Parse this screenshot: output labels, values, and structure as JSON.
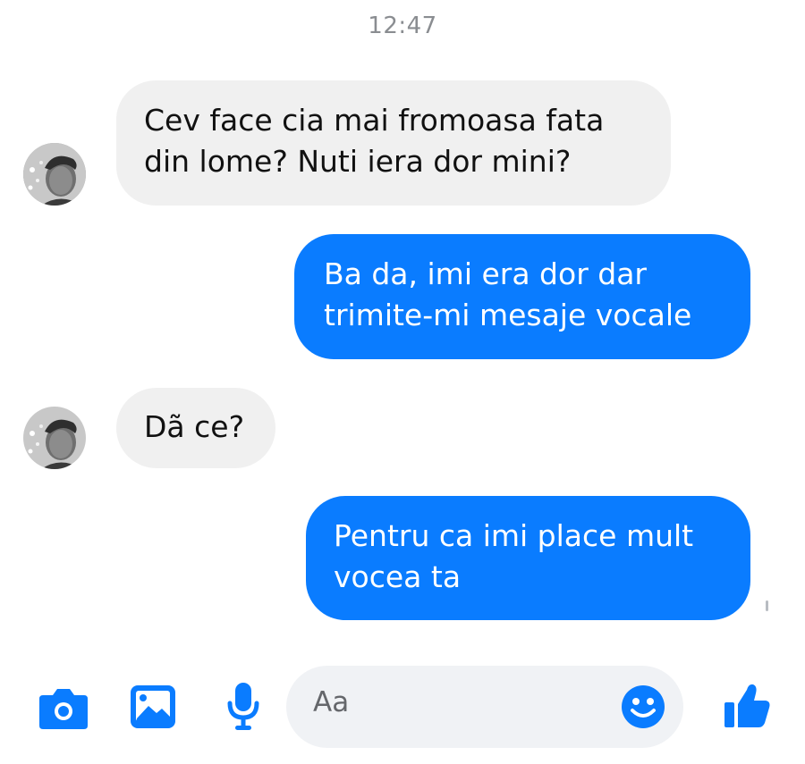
{
  "conversation": {
    "timestamp": "12:47",
    "messages": [
      {
        "direction": "incoming",
        "lines": [
          "Cev face cia mai fromoasa fata",
          "din lome? Nuti iera dor mini?"
        ]
      },
      {
        "direction": "outgoing",
        "lines": [
          "Ba da, imi era dor dar",
          "trimite-mi mesaje vocale"
        ]
      },
      {
        "direction": "incoming",
        "lines": [
          "Dã ce?"
        ]
      },
      {
        "direction": "outgoing",
        "lines": [
          "Pentru ca imi place mult",
          "vocea ta"
        ]
      }
    ]
  },
  "composer": {
    "placeholder": "Aa",
    "icons": [
      "camera-icon",
      "gallery-icon",
      "microphone-icon",
      "emoji-icon",
      "like-icon"
    ]
  },
  "colors": {
    "outgoing_bubble": "#0a7cff",
    "incoming_bubble": "#f0f0f0",
    "accent": "#0a7cff",
    "timestamp": "#8a8d91"
  }
}
